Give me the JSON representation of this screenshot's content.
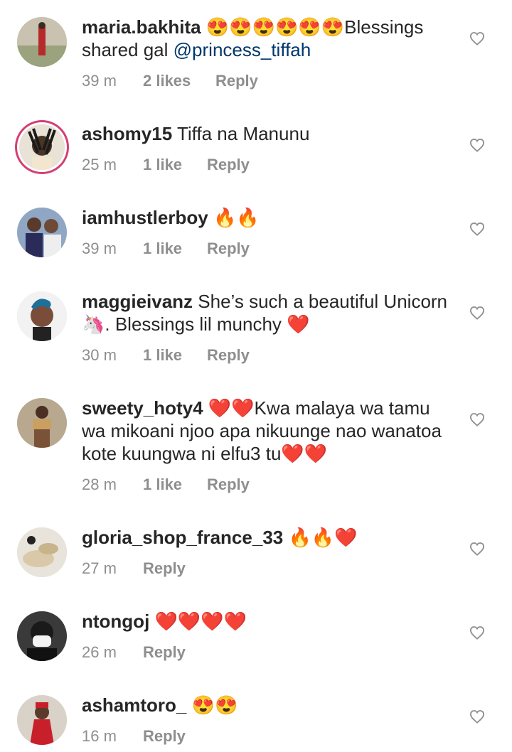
{
  "comments": [
    {
      "username": "maria.bakhita",
      "text_before": "😍😍😍😍😍😍Blessings shared gal ",
      "mention": "@princess_tiffah",
      "text_after": "",
      "time": "39 m",
      "likes": "2 likes",
      "reply": "Reply"
    },
    {
      "username": "ashomy15",
      "text_before": " Tiffa na Manunu",
      "mention": "",
      "text_after": "",
      "time": "25 m",
      "likes": "1 like",
      "reply": "Reply"
    },
    {
      "username": "iamhustlerboy",
      "text_before": " 🔥🔥",
      "mention": "",
      "text_after": "",
      "time": "39 m",
      "likes": "1 like",
      "reply": "Reply"
    },
    {
      "username": "maggieivanz",
      "text_before": " She’s such a beautiful Unicorn 🦄. Blessings lil munchy ❤️",
      "mention": "",
      "text_after": "",
      "time": "30 m",
      "likes": "1 like",
      "reply": "Reply"
    },
    {
      "username": "sweety_hoty4",
      "text_before": " ❤️❤️Kwa malaya wa tamu wa mikoani njoo apa nikuunge nao wanatoa kote kuungwa ni elfu3 tu❤️❤️",
      "mention": "",
      "text_after": "",
      "time": "28 m",
      "likes": "1 like",
      "reply": "Reply"
    },
    {
      "username": "gloria_shop_france_33",
      "text_before": " 🔥🔥❤️",
      "mention": "",
      "text_after": "",
      "time": "27 m",
      "likes": "",
      "reply": "Reply"
    },
    {
      "username": "ntongoj",
      "text_before": " ❤️❤️❤️❤️",
      "mention": "",
      "text_after": "",
      "time": "26 m",
      "likes": "",
      "reply": "Reply"
    },
    {
      "username": "ashamtoro_",
      "text_before": " 😍😍",
      "mention": "",
      "text_after": "",
      "time": "16 m",
      "likes": "",
      "reply": "Reply"
    }
  ],
  "icons": {
    "like": "heart-outline-icon"
  },
  "colors": {
    "mention": "#00376b",
    "meta": "#8e8e8e",
    "story_ring": "#d43f73"
  }
}
